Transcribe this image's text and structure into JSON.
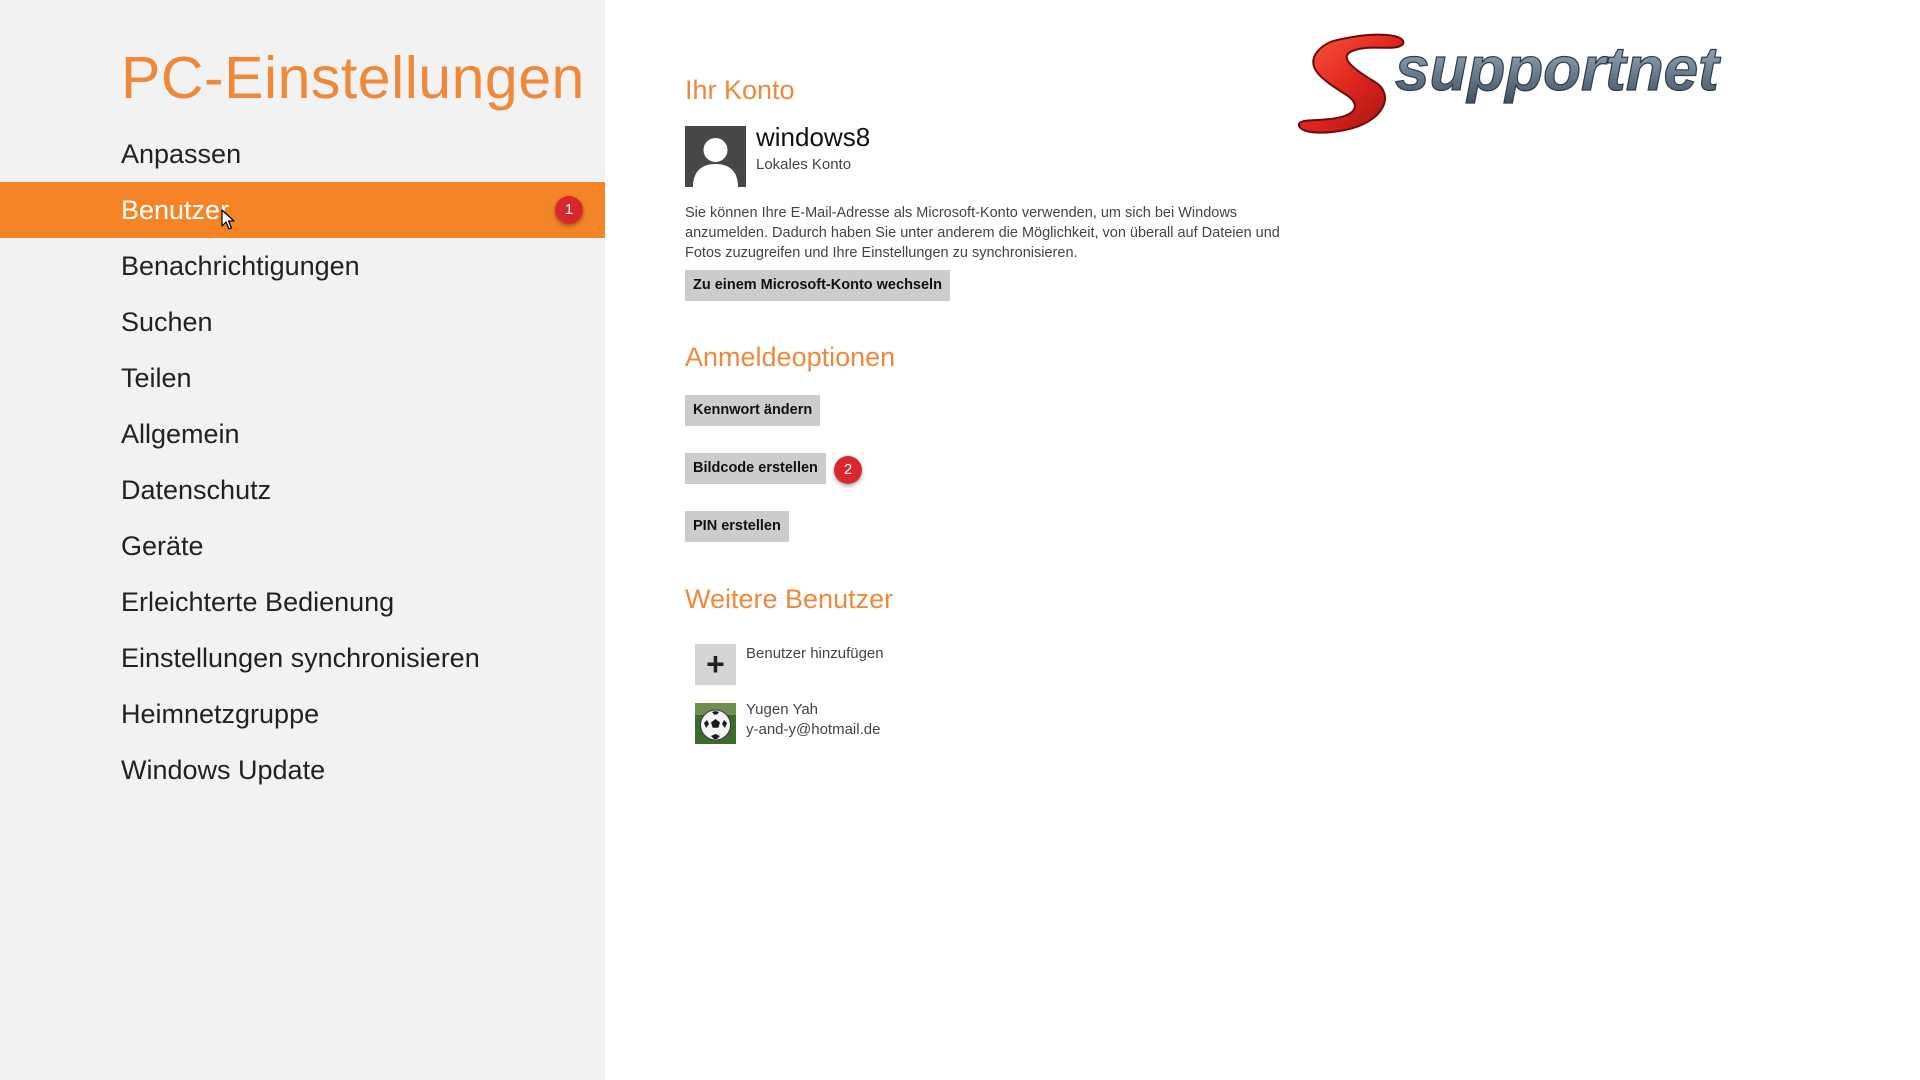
{
  "sidebar": {
    "title": "PC-Einstellungen",
    "items": [
      {
        "label": "Anpassen"
      },
      {
        "label": "Benutzer",
        "badge": "1"
      },
      {
        "label": "Benachrichtigungen"
      },
      {
        "label": "Suchen"
      },
      {
        "label": "Teilen"
      },
      {
        "label": "Allgemein"
      },
      {
        "label": "Datenschutz"
      },
      {
        "label": "Geräte"
      },
      {
        "label": "Erleichterte Bedienung"
      },
      {
        "label": "Einstellungen synchronisieren"
      },
      {
        "label": "Heimnetzgruppe"
      },
      {
        "label": "Windows Update"
      }
    ],
    "active_item": "Benutzer"
  },
  "account": {
    "section_title": "Ihr Konto",
    "name": "windows8",
    "type": "Lokales Konto",
    "description": "Sie können Ihre E-Mail-Adresse als Microsoft-Konto verwenden, um sich bei Windows anzumelden. Dadurch haben Sie unter anderem die Möglichkeit, von überall auf Dateien und Fotos zuzugreifen und Ihre Einstellungen zu synchronisieren.",
    "switch_button": "Zu einem Microsoft-Konto wechseln"
  },
  "signin": {
    "section_title": "Anmeldeoptionen",
    "change_password": "Kennwort ändern",
    "picture_password": "Bildcode erstellen",
    "picture_password_badge": "2",
    "pin": "PIN erstellen"
  },
  "other_users": {
    "section_title": "Weitere Benutzer",
    "add_user": "Benutzer hinzufügen",
    "add_icon": "plus-icon",
    "users": [
      {
        "name": "Yugen Yah",
        "email": "y-and-y@hotmail.de"
      }
    ]
  },
  "logo": {
    "text": "supportnet"
  },
  "colors": {
    "accent": "#f58426",
    "title": "#f0883a",
    "sidebar_bg": "#f2f2f2",
    "badge": "#d9272e",
    "button_bg": "#cccccc"
  }
}
